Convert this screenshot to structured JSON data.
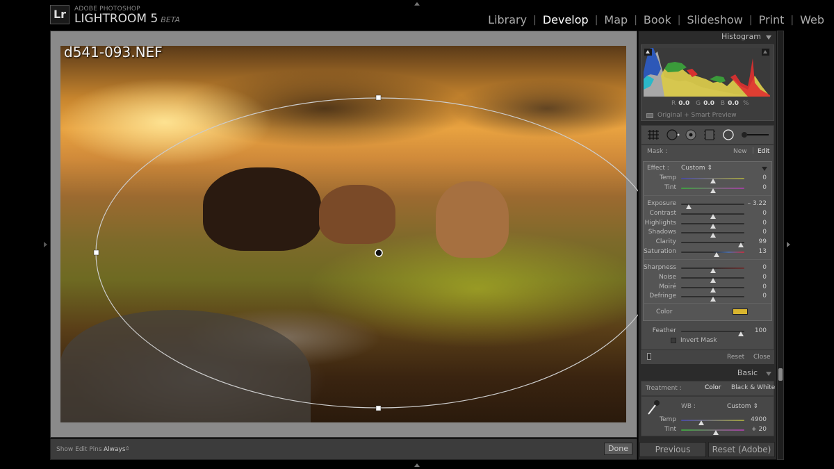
{
  "header": {
    "logo": "Lr",
    "brand_small": "ADOBE PHOTOSHOP",
    "brand_main": "LIGHTROOM 5",
    "brand_tag": "BETA",
    "modules": [
      {
        "label": "Library",
        "active": false
      },
      {
        "label": "Develop",
        "active": true
      },
      {
        "label": "Map",
        "active": false
      },
      {
        "label": "Book",
        "active": false
      },
      {
        "label": "Slideshow",
        "active": false
      },
      {
        "label": "Print",
        "active": false
      },
      {
        "label": "Web",
        "active": false
      }
    ]
  },
  "viewer": {
    "filename": "d541-093.NEF",
    "toolbar": {
      "pins_label": "Show Edit Pins :",
      "pins_value": "Always",
      "pins_arrow": "⇕",
      "done": "Done"
    }
  },
  "histogram": {
    "title": "Histogram",
    "readout": {
      "r_label": "R",
      "r": "0.0",
      "g_label": "G",
      "g": "0.0",
      "b_label": "B",
      "b": "0.0",
      "unit": "%"
    },
    "preview_label": "Original + Smart Preview"
  },
  "tools": [
    "crop-overlay",
    "spot-removal",
    "red-eye",
    "graduated-filter",
    "radial-filter",
    "adjustment-brush"
  ],
  "mask": {
    "label": "Mask :",
    "new": "New",
    "edit": "Edit",
    "effect_label": "Effect :",
    "effect_value": "Custom ⇕",
    "sliders_a": [
      {
        "label": "Temp",
        "value": "0",
        "position": 0.5
      },
      {
        "label": "Tint",
        "value": "0",
        "position": 0.5
      }
    ],
    "sliders_b": [
      {
        "label": "Exposure",
        "value": "– 3.22",
        "position": 0.12
      },
      {
        "label": "Contrast",
        "value": "0",
        "position": 0.5
      },
      {
        "label": "Highlights",
        "value": "0",
        "position": 0.5
      },
      {
        "label": "Shadows",
        "value": "0",
        "position": 0.5
      },
      {
        "label": "Clarity",
        "value": "99",
        "position": 0.95
      },
      {
        "label": "Saturation",
        "value": "13",
        "position": 0.56
      }
    ],
    "sliders_c": [
      {
        "label": "Sharpness",
        "value": "0",
        "position": 0.5
      },
      {
        "label": "Noise",
        "value": "0",
        "position": 0.5
      },
      {
        "label": "Moiré",
        "value": "0",
        "position": 0.5
      },
      {
        "label": "Defringe",
        "value": "0",
        "position": 0.5
      }
    ],
    "color_label": "Color",
    "color_swatch": "#d9b52e",
    "feather": {
      "label": "Feather",
      "value": "100",
      "position": 0.95
    },
    "invert_label": "Invert Mask",
    "reset": "Reset",
    "close": "Close"
  },
  "basic": {
    "title": "Basic",
    "treatment_label": "Treatment :",
    "treatment_color": "Color",
    "treatment_bw": "Black & White",
    "wb_label": "WB :",
    "wb_value": "Custom ⇕",
    "sliders": [
      {
        "label": "Temp",
        "value": "4900",
        "position": 0.32
      },
      {
        "label": "Tint",
        "value": "+ 20",
        "position": 0.55
      }
    ]
  },
  "footer": {
    "previous": "Previous",
    "reset": "Reset (Adobe)"
  }
}
